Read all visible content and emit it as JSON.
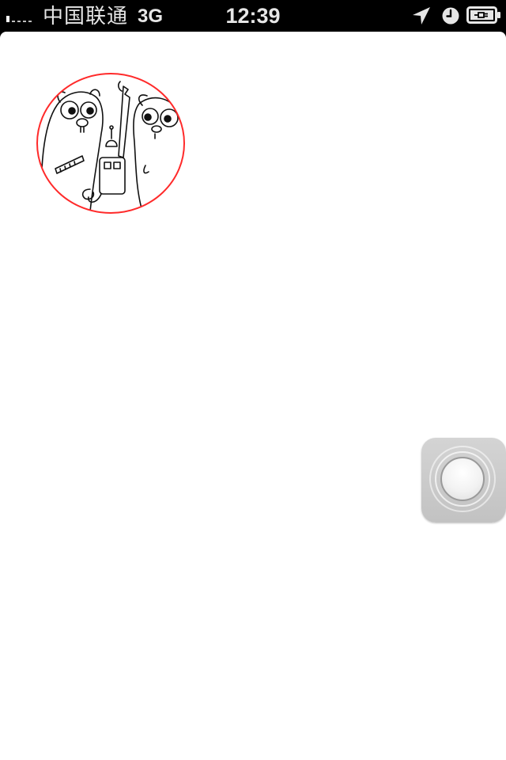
{
  "status_bar": {
    "signal_bars": 5,
    "signal_strength": 1,
    "carrier": "中国联通",
    "network": "3G",
    "time": "12:39",
    "icons": [
      "location-arrow-icon",
      "alarm-clock-icon",
      "battery-charging-icon"
    ]
  },
  "content": {
    "image_subject": "gopher-mascots-cartoon",
    "image_outline_color": "#ff2a2a"
  },
  "assistive_touch": {
    "icon": "assistive-touch-button"
  },
  "colors": {
    "status_bar_bg": "#000000",
    "status_text": "#e6e6e6",
    "screen_bg": "#ffffff",
    "image_outline": "#ff2a2a"
  }
}
